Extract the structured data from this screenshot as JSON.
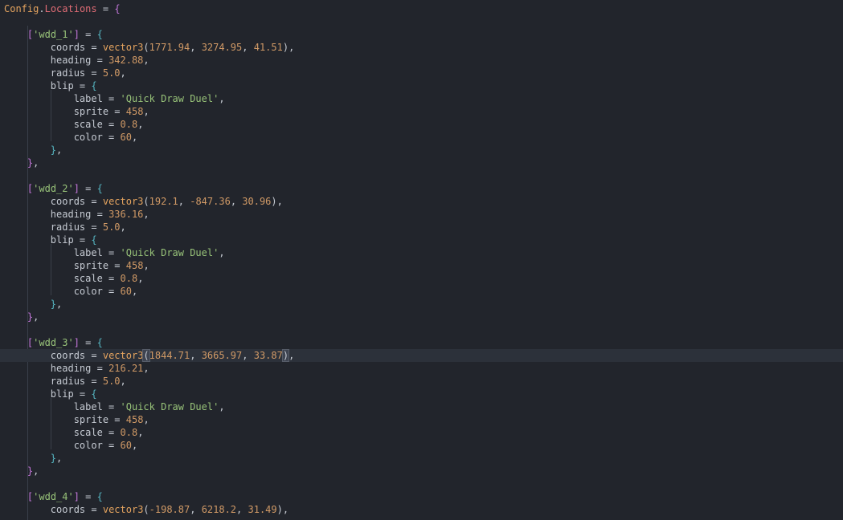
{
  "header": {
    "object": "Config",
    "field": "Locations"
  },
  "labels": {
    "coords": "coords",
    "heading": "heading",
    "radius": "radius",
    "blip": "blip",
    "label": "label",
    "sprite": "sprite",
    "scale": "scale",
    "color": "color",
    "fn": "vector3"
  },
  "locations": [
    {
      "key": "'wdd_1'",
      "coords": [
        "1771.94",
        "3274.95",
        "41.51"
      ],
      "heading": "342.88",
      "radius": "5.0",
      "blip": {
        "label": "'Quick Draw Duel'",
        "sprite": "458",
        "scale": "0.8",
        "color": "60"
      }
    },
    {
      "key": "'wdd_2'",
      "coords": [
        "192.1",
        "-847.36",
        "30.96"
      ],
      "heading": "336.16",
      "radius": "5.0",
      "blip": {
        "label": "'Quick Draw Duel'",
        "sprite": "458",
        "scale": "0.8",
        "color": "60"
      }
    },
    {
      "key": "'wdd_3'",
      "coords": [
        "1844.71",
        "3665.97",
        "33.87"
      ],
      "heading": "216.21",
      "radius": "5.0",
      "blip": {
        "label": "'Quick Draw Duel'",
        "sprite": "458",
        "scale": "0.8",
        "color": "60"
      }
    },
    {
      "key": "'wdd_4'",
      "coords": [
        "-198.87",
        "6218.2",
        "31.49"
      ]
    }
  ],
  "current_line_block": 2
}
